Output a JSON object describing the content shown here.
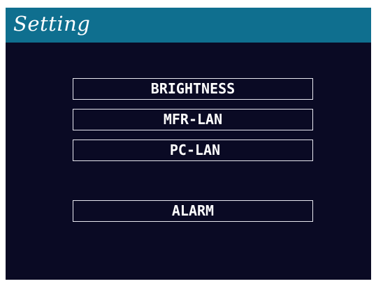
{
  "header": {
    "title": "Setting"
  },
  "menu": {
    "items": [
      {
        "label": "BRIGHTNESS"
      },
      {
        "label": "MFR-LAN"
      },
      {
        "label": "PC-LAN"
      },
      {
        "label": "ALARM"
      }
    ]
  },
  "colors": {
    "title_bar": "#0f6f8f",
    "screen_background": "#0a0a24",
    "button_border": "#e8e8f0",
    "text": "#ffffff"
  }
}
